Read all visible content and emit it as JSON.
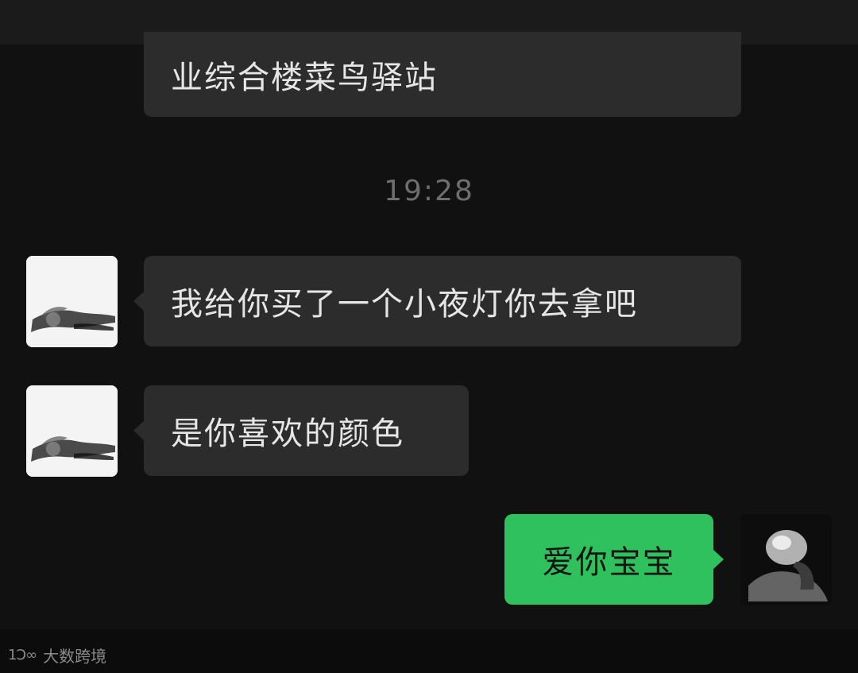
{
  "chat": {
    "messages": [
      {
        "side": "incoming",
        "text": "业综合楼菜鸟驿站"
      },
      {
        "side": "timestamp",
        "text": "19:28"
      },
      {
        "side": "incoming",
        "text": "我给你买了一个小夜灯你去拿吧"
      },
      {
        "side": "incoming",
        "text": "是你喜欢的颜色"
      },
      {
        "side": "outgoing",
        "text": "爱你宝宝"
      }
    ]
  },
  "watermark": {
    "logo": "1Ɔ∞",
    "text": "大数跨境"
  },
  "colors": {
    "background": "#111111",
    "incoming_bubble": "#2c2c2c",
    "outgoing_bubble": "#2fc15d",
    "timestamp": "#6e6e6e"
  }
}
